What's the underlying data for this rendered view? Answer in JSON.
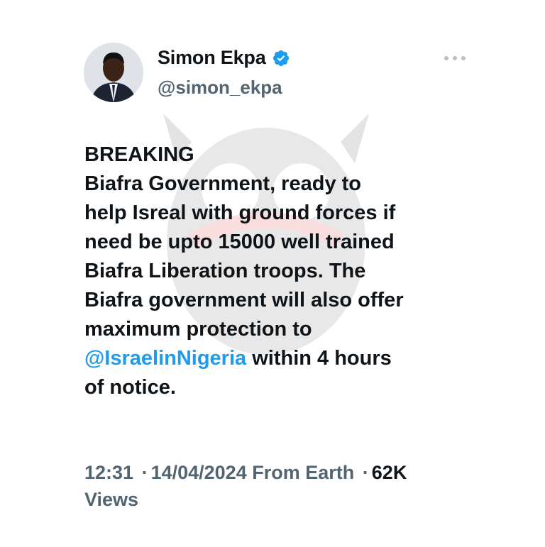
{
  "author": {
    "display_name": "Simon Ekpa",
    "handle": "@simon_ekpa",
    "verified": true
  },
  "tweet": {
    "line1": "BREAKING",
    "line2": "Biafra Government, ready to",
    "line3": "help Isreal with ground forces if",
    "line4": "need be upto 15000 well trained",
    "line5": "Biafra Liberation troops. The",
    "line6": "Biafra government will also offer",
    "line7": "maximum protection to",
    "mention": "@IsraelinNigeria",
    "line8_rest": " within 4 hours",
    "line9": "of notice."
  },
  "meta": {
    "time": "12:31",
    "separator": "·",
    "date": "14/04/2024",
    "source": "From Earth",
    "views_count": "62K",
    "views_label": "Views"
  },
  "colors": {
    "accent": "#1d9bf0",
    "text": "#0f1419",
    "muted": "#536471"
  },
  "icons": {
    "verified": "verified-badge-icon",
    "more": "more-options-icon"
  }
}
